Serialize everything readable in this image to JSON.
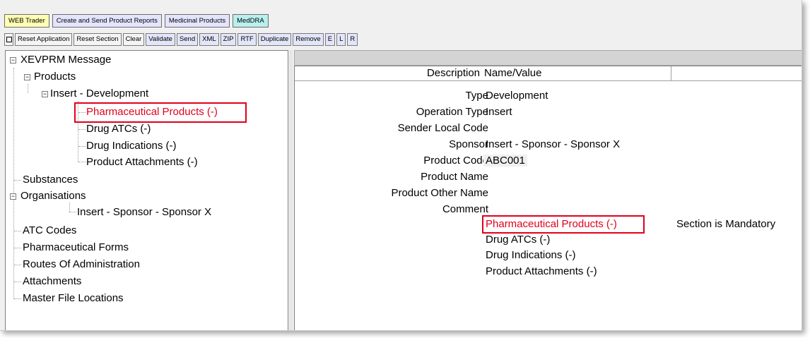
{
  "tabs": [
    "WEB Trader",
    "Create and Send Product Reports",
    "Medicinal Products",
    "MedDRA"
  ],
  "toolbar": {
    "buttons": [
      "Reset Application",
      "Reset Section",
      "Clear",
      "Validate",
      "Send",
      "XML",
      "ZIP",
      "RTF",
      "Duplicate",
      "Remove",
      "E",
      "L",
      "R"
    ]
  },
  "tree": {
    "root": "XEVPRM Message",
    "products": "Products",
    "insert_dev": "Insert - Development",
    "pharma": "Pharmaceutical Products (-)",
    "drug_atcs": "Drug ATCs (-)",
    "drug_ind": "Drug Indications (-)",
    "attachments_prod": "Product Attachments (-)",
    "substances": "Substances",
    "organisations": "Organisations",
    "sponsor": "Insert - Sponsor - Sponsor X",
    "atc_codes": "ATC Codes",
    "pharm_forms": "Pharmaceutical Forms",
    "routes": "Routes Of Administration",
    "attachments": "Attachments",
    "master_file": "Master File Locations"
  },
  "grid": {
    "col_desc": "Description",
    "col_value": "Name/Value",
    "rows": [
      {
        "desc": "Type",
        "value": "Development"
      },
      {
        "desc": "Operation Type",
        "value": "Insert"
      },
      {
        "desc": "Sender Local Code",
        "value": ""
      },
      {
        "desc": "Sponsor",
        "value": "Insert - Sponsor - Sponsor X"
      },
      {
        "desc": "Product Code",
        "value": "ABC001"
      },
      {
        "desc": "Product Name",
        "value": ""
      },
      {
        "desc": "Product Other Name",
        "value": ""
      },
      {
        "desc": "Comment",
        "value": ""
      }
    ],
    "sections": [
      "Pharmaceutical Products (-)",
      "Drug ATCs (-)",
      "Drug Indications (-)",
      "Product Attachments (-)"
    ],
    "mandatory_note": "Section is Mandatory"
  },
  "colors": {
    "highlight": "#e0001b"
  }
}
